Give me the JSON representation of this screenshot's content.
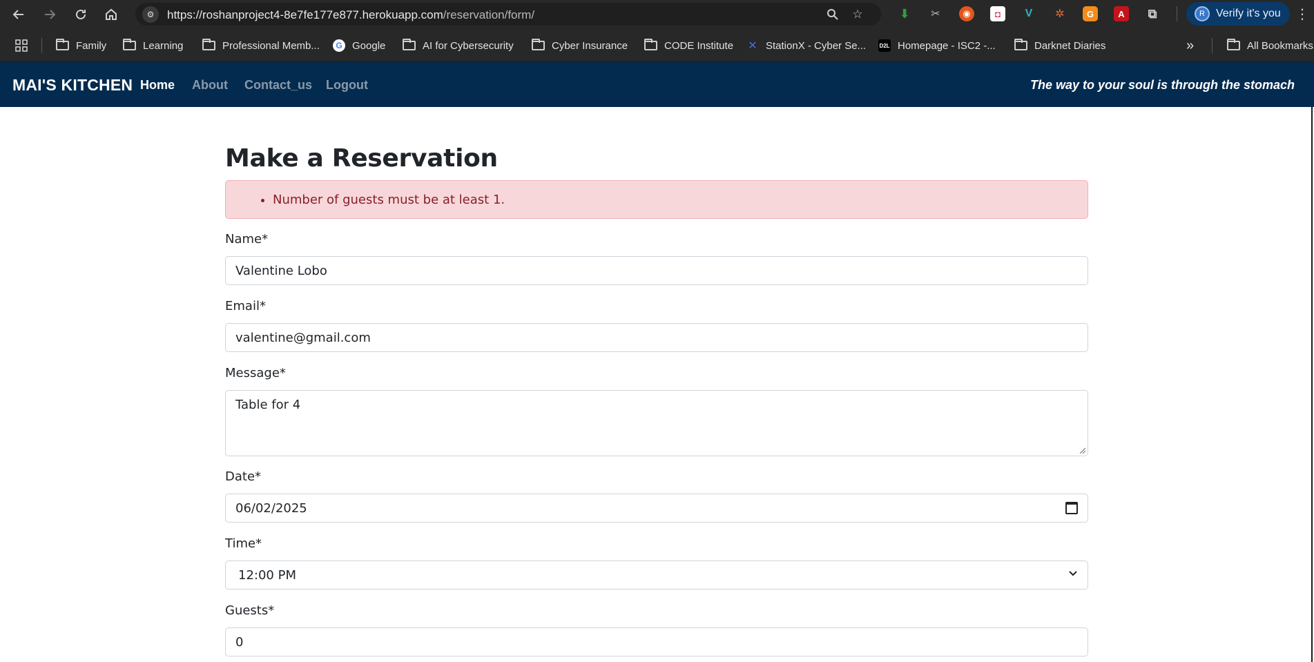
{
  "browser": {
    "url_host": "https://roshanproject4-8e7fe177e877.herokuapp.com",
    "url_path": "/reservation/form/",
    "verify_label": "Verify it's you",
    "avatar_letter": "R",
    "bookmarks": [
      {
        "label": "Family",
        "icon": "folder-icon"
      },
      {
        "label": "Learning",
        "icon": "folder-icon"
      },
      {
        "label": "Professional Memb...",
        "icon": "folder-icon"
      },
      {
        "label": "Google",
        "icon": "google-icon"
      },
      {
        "label": "AI for Cybersecurity",
        "icon": "folder-icon"
      },
      {
        "label": "Cyber Insurance",
        "icon": "folder-icon"
      },
      {
        "label": "CODE Institute",
        "icon": "folder-icon"
      },
      {
        "label": "StationX - Cyber Se...",
        "icon": "stationx-icon"
      },
      {
        "label": "Homepage - ISC2 -...",
        "icon": "d2l-icon"
      },
      {
        "label": "Darknet Diaries",
        "icon": "folder-icon"
      }
    ],
    "overflow_label": "»",
    "all_bookmarks_label": "All Bookmarks"
  },
  "site": {
    "brand": "MAI'S KITCHEN",
    "nav": [
      {
        "label": "Home",
        "active": true
      },
      {
        "label": "About",
        "active": false
      },
      {
        "label": "Contact_us",
        "active": false
      },
      {
        "label": "Logout",
        "active": false
      }
    ],
    "tagline": "The way to your soul is through the stomach"
  },
  "form": {
    "title": "Make a Reservation",
    "errors": [
      "Number of guests must be at least 1."
    ],
    "fields": {
      "name": {
        "label": "Name*",
        "value": "Valentine Lobo"
      },
      "email": {
        "label": "Email*",
        "value": "valentine@gmail.com"
      },
      "message": {
        "label": "Message*",
        "value": "Table for 4"
      },
      "date": {
        "label": "Date*",
        "value": "06/02/2025"
      },
      "time": {
        "label": "Time*",
        "value": "12:00 PM"
      },
      "guests": {
        "label": "Guests*",
        "value": "0"
      }
    }
  },
  "colors": {
    "navbar": "#022b4f",
    "alert_bg": "#f8d7da",
    "alert_text": "#842029"
  }
}
